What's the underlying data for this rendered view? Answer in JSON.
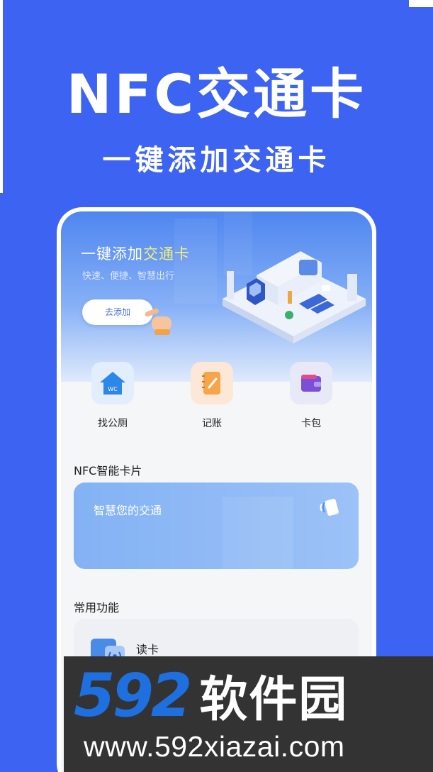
{
  "hero": {
    "title": "NFC交通卡",
    "subtitle": "一键添加交通卡"
  },
  "banner": {
    "title_prefix": "一键添加",
    "title_highlight": "交通卡",
    "slogan": "快速、便捷、智慧出行",
    "add_button": "去添加"
  },
  "quick_actions": [
    {
      "label": "找公厕",
      "icon": "toilet-icon",
      "badge": "WC"
    },
    {
      "label": "记账",
      "icon": "notebook-icon"
    },
    {
      "label": "卡包",
      "icon": "wallet-icon"
    }
  ],
  "nfc_section": {
    "title": "NFC智能卡片",
    "card_text": "智慧您的交通"
  },
  "common_section": {
    "title": "常用功能",
    "items": [
      {
        "label": "读卡",
        "icon": "nfc-read-icon"
      }
    ]
  },
  "watermark": {
    "digits": "592",
    "name": "软件园",
    "url": "www.592xiazai.com"
  },
  "colors": {
    "background": "#3d63f2",
    "highlight": "#f4f07a",
    "watermark_bg": "#333333",
    "watermark_digits": "#1e6fe0"
  }
}
